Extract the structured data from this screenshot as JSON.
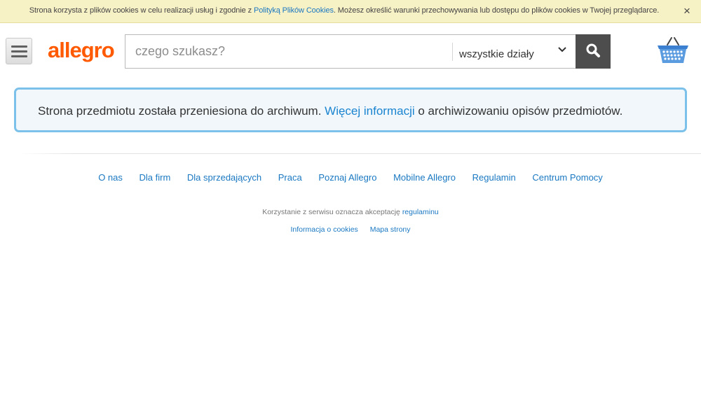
{
  "cookie_bar": {
    "text_before": "Strona korzysta z plików cookies w celu realizacji usług i zgodnie z ",
    "link_label": "Polityką Plików Cookies",
    "text_after": ". Możesz określić warunki przechowywania lub dostępu do plików cookies w Twojej przeglądarce.",
    "close_label": "×"
  },
  "header": {
    "logo": "allegro",
    "search": {
      "placeholder": "czego szukasz?",
      "value": "",
      "category": "wszystkie działy"
    }
  },
  "notice": {
    "text_before": "Strona przedmiotu została przeniesiona do archiwum. ",
    "link_label": "Więcej informacji",
    "text_after": " o archiwizowaniu opisów przedmiotów."
  },
  "footer": {
    "links": [
      "O nas",
      "Dla firm",
      "Dla sprzedających",
      "Praca",
      "Poznaj Allegro",
      "Mobilne Allegro",
      "Regulamin",
      "Centrum Pomocy"
    ],
    "legal_text": "Korzystanie z serwisu oznacza akceptację ",
    "legal_link": "regulaminu",
    "bottom_links": [
      "Informacja o cookies",
      "Mapa strony"
    ]
  },
  "colors": {
    "brand": "#ff5a00",
    "link": "#1a78c2",
    "notice_border": "#7cc1ea",
    "cookie_bg": "#f7f1c6"
  },
  "icons": {
    "menu": "hamburger-icon",
    "search": "search-icon",
    "category": "chevron-down-icon",
    "basket": "basket-icon",
    "close": "close-icon"
  }
}
